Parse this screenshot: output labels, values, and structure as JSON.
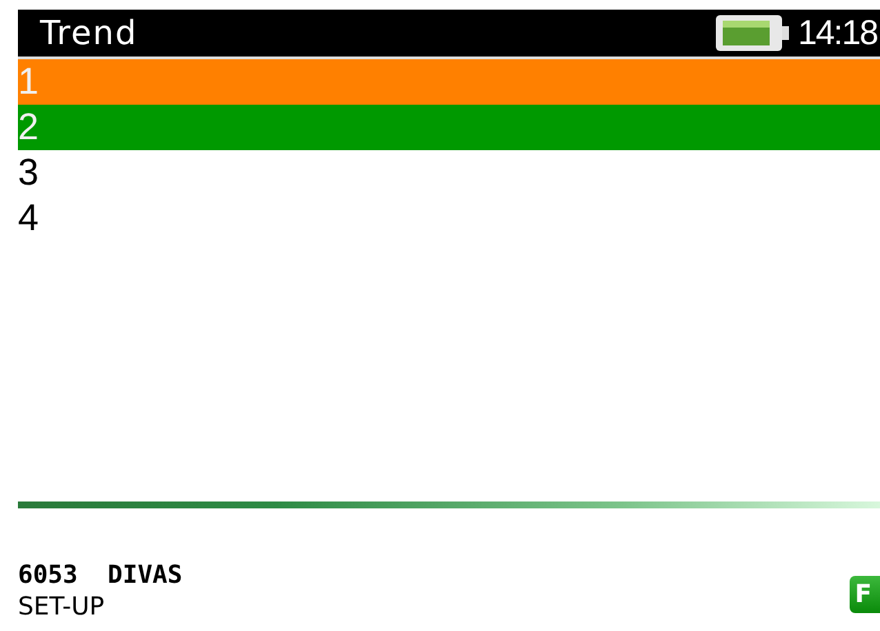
{
  "header": {
    "title": "Trend",
    "time": "14:18"
  },
  "rows": [
    {
      "label": "1",
      "color": "#ff8000"
    },
    {
      "label": "2",
      "color": "#009900"
    },
    {
      "label": "3",
      "color": "#ffffff"
    },
    {
      "label": "4",
      "color": "#ffffff"
    }
  ],
  "footer": {
    "device": "6053  DIVAS",
    "mode": "SET-UP",
    "key": "F"
  }
}
